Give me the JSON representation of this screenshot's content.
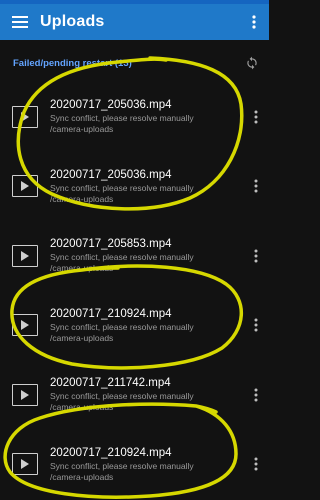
{
  "app": {
    "title": "Uploads"
  },
  "section": {
    "title": "Failed/pending restart (13)"
  },
  "icons": {
    "menu": "hamburger-menu-icon",
    "overflow": "more-vertical-icon",
    "retry": "sync-icon",
    "video": "play-icon"
  },
  "colors": {
    "appbar": "#1f79c9",
    "section_title": "#63a4ff",
    "annotation": "#d6d800"
  },
  "uploads": [
    {
      "filename": "20200717_205036.mp4",
      "status": "Sync conflict, please resolve manually",
      "path": "/camera-uploads"
    },
    {
      "filename": "20200717_205036.mp4",
      "status": "Sync conflict, please resolve manually",
      "path": "/camera-uploads"
    },
    {
      "filename": "20200717_205853.mp4",
      "status": "Sync conflict, please resolve manually",
      "path": "/camera-uploads"
    },
    {
      "filename": "20200717_210924.mp4",
      "status": "Sync conflict, please resolve manually",
      "path": "/camera-uploads"
    },
    {
      "filename": "20200717_211742.mp4",
      "status": "Sync conflict, please resolve manually",
      "path": "/camera-uploads"
    },
    {
      "filename": "20200717_210924.mp4",
      "status": "Sync conflict, please resolve manually",
      "path": "/camera-uploads"
    }
  ]
}
